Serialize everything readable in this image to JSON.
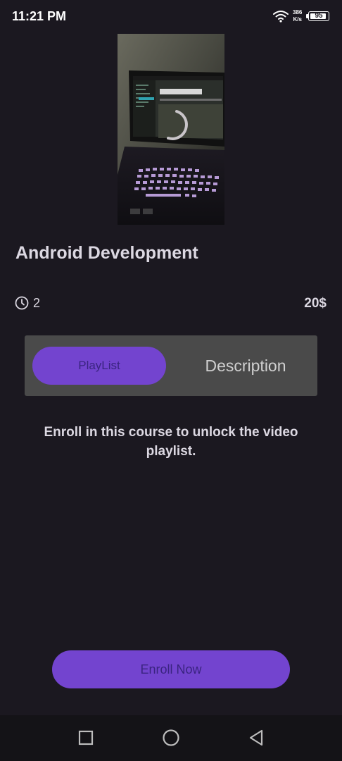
{
  "status_bar": {
    "time": "11:21 PM",
    "net_speed_value": "386",
    "net_speed_unit": "K/s",
    "battery": "95",
    "battery_level": 0.95
  },
  "course": {
    "thumbnail_alt": "laptop photo",
    "title": "Android Development",
    "duration": "2",
    "price": "20$"
  },
  "tabs": {
    "playlist_label": "PlayList",
    "description_label": "Description",
    "active": "PlayList"
  },
  "content": {
    "lock_message": "Enroll in this course to unlock the video playlist."
  },
  "actions": {
    "enroll_label": "Enroll Now"
  },
  "nav": {
    "icons": [
      "recents-square-icon",
      "home-circle-icon",
      "back-triangle-icon"
    ]
  },
  "colors": {
    "background": "#1b1820",
    "accent": "#7344cf",
    "tab_bar": "#4a4a4a"
  }
}
